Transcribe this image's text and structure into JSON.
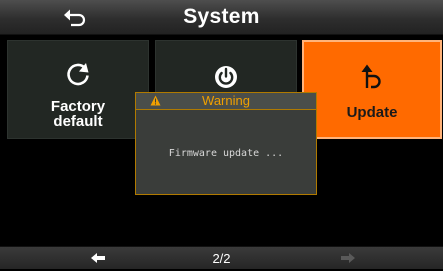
{
  "header": {
    "title": "System",
    "back_icon": "back-arrow-icon"
  },
  "tiles": [
    {
      "label_line1": "Factory",
      "label_line2": "default",
      "icon": "refresh-icon"
    },
    {
      "icon": "power-icon"
    },
    {
      "label": "Update",
      "icon": "update-arrow-icon",
      "selected": true
    }
  ],
  "dialog": {
    "title": "Warning",
    "message": "Firmware update ...",
    "icon": "warning-icon"
  },
  "footer": {
    "page": "2/2",
    "prev_icon": "arrow-left-icon",
    "next_icon": "arrow-right-icon",
    "next_enabled": false
  },
  "colors": {
    "accent": "#ff6a00",
    "warning": "#f0a000",
    "tile": "#222723"
  }
}
